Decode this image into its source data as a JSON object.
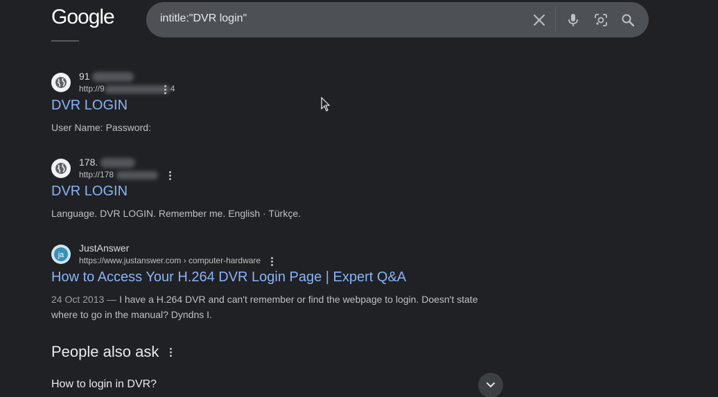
{
  "header": {
    "logo": "Google",
    "search_query": "intitle:\"DVR login\"",
    "clear_icon": "close-icon",
    "voice_icon": "mic-icon",
    "lens_icon": "camera-lens-icon",
    "search_icon": "search-icon"
  },
  "results": [
    {
      "site_name": "91",
      "url_prefix": "http://9",
      "url_suffix": "4",
      "title": "DVR LOGIN",
      "snippet": "User Name: Password:",
      "favicon": "globe-icon"
    },
    {
      "site_name": "178.",
      "url_prefix": "http://178",
      "url_suffix": "",
      "title": "DVR LOGIN",
      "snippet": "Language. DVR LOGIN. Remember me. English · Türkçe.",
      "favicon": "globe-icon"
    },
    {
      "site_name": "JustAnswer",
      "url": "https://www.justanswer.com › computer-hardware",
      "title": "How to Access Your H.264 DVR Login Page | Expert Q&A",
      "date": "24 Oct 2013 — ",
      "snippet": "I have a H.264 DVR and can't remember or find the webpage to login. Doesn't state where to go in the manual? Dyndns I.",
      "favicon_text": "ja"
    }
  ],
  "people_also_ask": {
    "title": "People also ask",
    "questions": [
      "How to login in DVR?"
    ]
  },
  "colors": {
    "background": "#202124",
    "link": "#8ab4f8",
    "searchbox": "#4d5156"
  }
}
